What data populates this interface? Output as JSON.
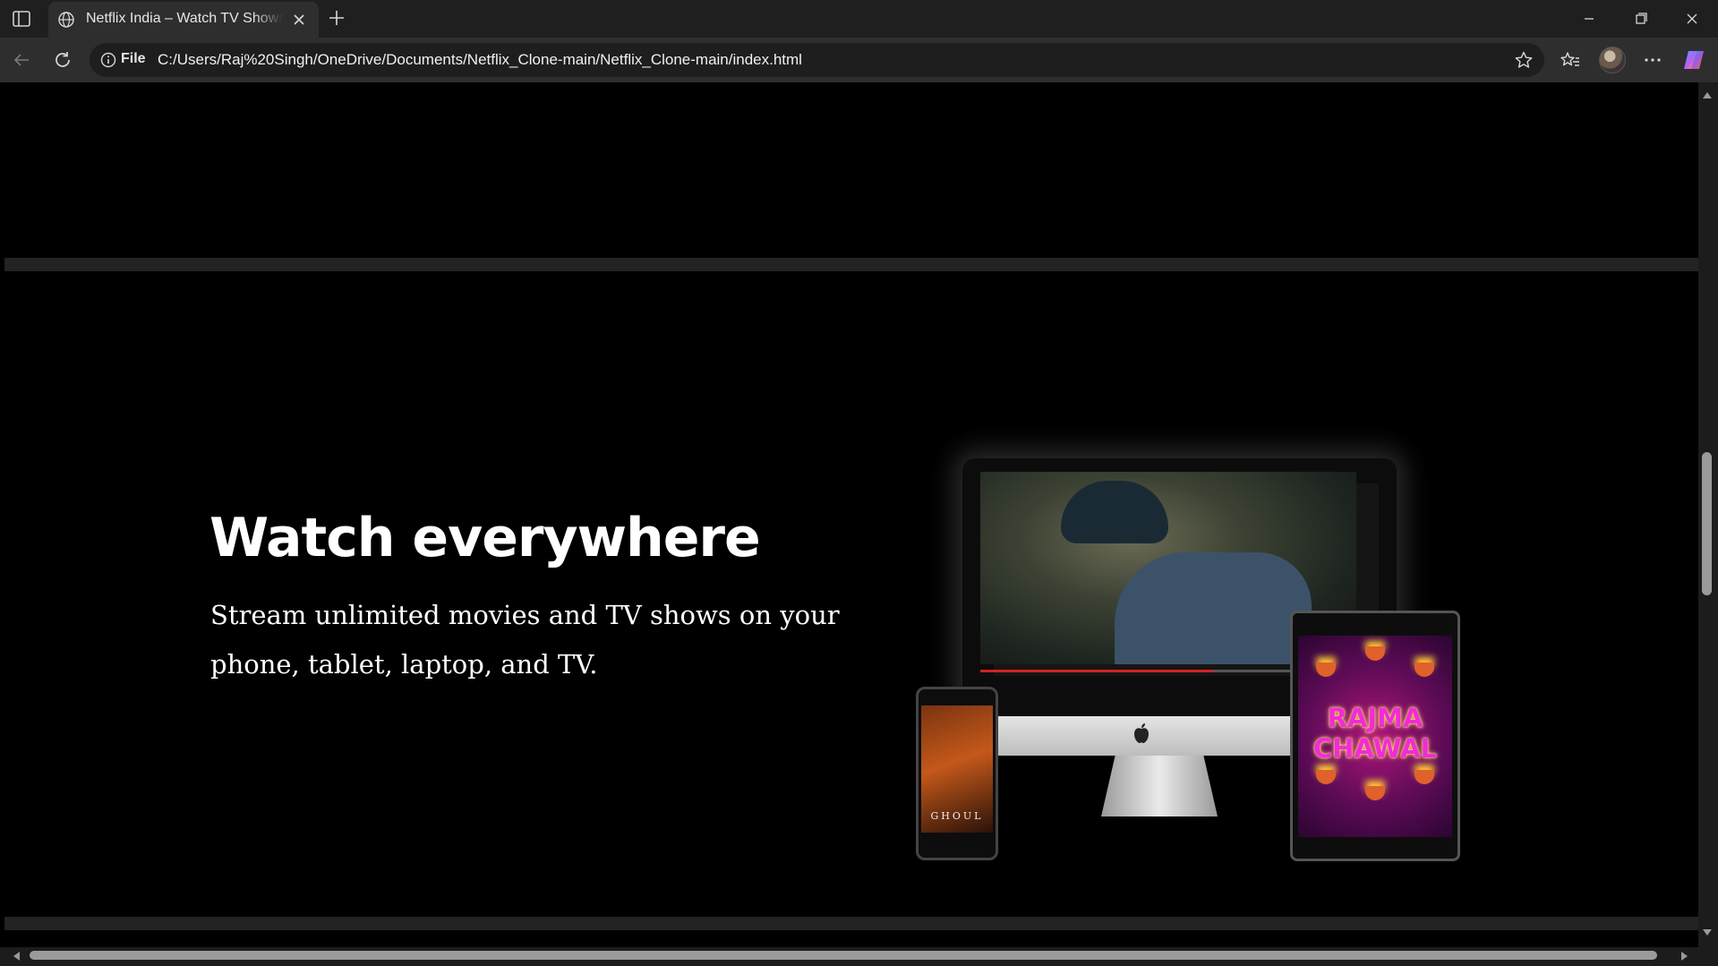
{
  "browser": {
    "tab": {
      "title": "Netflix India – Watch TV Shows O"
    },
    "address": {
      "scheme_label": "File",
      "url": "C:/Users/Raj%20Singh/OneDrive/Documents/Netflix_Clone-main/Netflix_Clone-main/index.html"
    }
  },
  "page": {
    "hero": {
      "heading": "Watch everywhere",
      "subtext": "Stream unlimited movies and TV shows on your phone, tablet, laptop, and TV."
    },
    "devices": {
      "phone_title": "GHOUL",
      "tablet_title_line1": "RAJMA",
      "tablet_title_line2": "CHAWAL"
    },
    "video_progress": 0.62
  },
  "colors": {
    "accent": "#d22222",
    "background": "#000000",
    "divider": "#232323"
  }
}
